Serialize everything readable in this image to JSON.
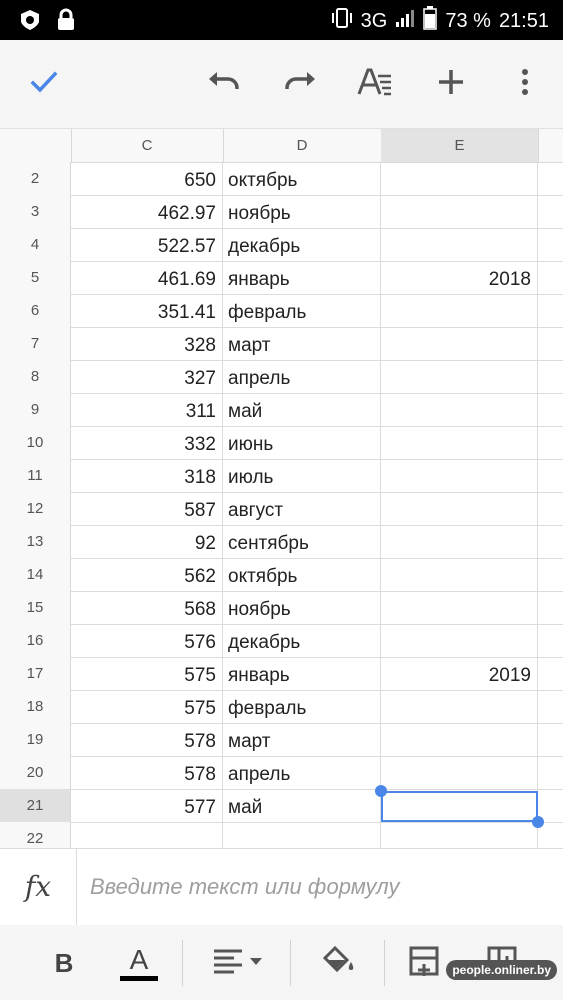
{
  "status_bar": {
    "network": "3G",
    "battery": "73 %",
    "time": "21:51"
  },
  "toolbar": {
    "icons": [
      "check-icon",
      "undo-icon",
      "redo-icon",
      "text-format-icon",
      "add-icon",
      "more-vert-icon"
    ]
  },
  "columns": [
    "C",
    "D",
    "E"
  ],
  "rows": [
    {
      "num": "2",
      "c": "650",
      "d": "октябрь",
      "e": ""
    },
    {
      "num": "3",
      "c": "462.97",
      "d": "ноябрь",
      "e": ""
    },
    {
      "num": "4",
      "c": "522.57",
      "d": "декабрь",
      "e": ""
    },
    {
      "num": "5",
      "c": "461.69",
      "d": "январь",
      "e": "2018"
    },
    {
      "num": "6",
      "c": "351.41",
      "d": "февраль",
      "e": ""
    },
    {
      "num": "7",
      "c": "328",
      "d": "март",
      "e": ""
    },
    {
      "num": "8",
      "c": "327",
      "d": "апрель",
      "e": ""
    },
    {
      "num": "9",
      "c": "311",
      "d": "май",
      "e": ""
    },
    {
      "num": "10",
      "c": "332",
      "d": "июнь",
      "e": ""
    },
    {
      "num": "11",
      "c": "318",
      "d": "июль",
      "e": ""
    },
    {
      "num": "12",
      "c": "587",
      "d": "август",
      "e": ""
    },
    {
      "num": "13",
      "c": "92",
      "d": "сентябрь",
      "e": ""
    },
    {
      "num": "14",
      "c": "562",
      "d": "октябрь",
      "e": ""
    },
    {
      "num": "15",
      "c": "568",
      "d": "ноябрь",
      "e": ""
    },
    {
      "num": "16",
      "c": "576",
      "d": "декабрь",
      "e": ""
    },
    {
      "num": "17",
      "c": "575",
      "d": "январь",
      "e": "2019"
    },
    {
      "num": "18",
      "c": "575",
      "d": "февраль",
      "e": ""
    },
    {
      "num": "19",
      "c": "578",
      "d": "март",
      "e": ""
    },
    {
      "num": "20",
      "c": "578",
      "d": "апрель",
      "e": ""
    },
    {
      "num": "21",
      "c": "577",
      "d": "май",
      "e": ""
    },
    {
      "num": "22",
      "c": "",
      "d": "",
      "e": ""
    }
  ],
  "selected_row": "21",
  "formula_bar": {
    "fx_label": "fx",
    "placeholder": "Введите текст или формулу"
  },
  "bottom_toolbar": {
    "bold_label": "B",
    "text_color_label": "A"
  },
  "watermark": "people.onliner.by",
  "colors": {
    "accent": "#4a86e8",
    "toolbar_bg": "#f5f5f5",
    "header_bg": "#f8f8f8"
  }
}
